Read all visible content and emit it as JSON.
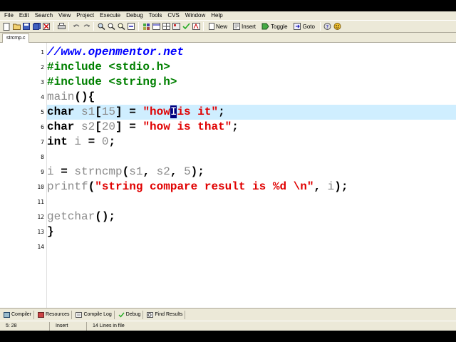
{
  "menu": {
    "items": [
      {
        "label": "File"
      },
      {
        "label": "Edit"
      },
      {
        "label": "Search"
      },
      {
        "label": "View"
      },
      {
        "label": "Project"
      },
      {
        "label": "Execute"
      },
      {
        "label": "Debug"
      },
      {
        "label": "Tools"
      },
      {
        "label": "CVS"
      },
      {
        "label": "Window"
      },
      {
        "label": "Help"
      }
    ]
  },
  "toolbar": {
    "new_label": "New",
    "insert_label": "Insert",
    "toggle_label": "Toggle",
    "goto_label": "Goto"
  },
  "tabs": {
    "file_tab": "strcmp.c"
  },
  "editor": {
    "line_numbers": [
      "1",
      "2",
      "3",
      "4",
      "5",
      "6",
      "7",
      "8",
      "9",
      "10",
      "11",
      "12",
      "13",
      "14"
    ],
    "lines": [
      {
        "parts": [
          {
            "cls": "cm",
            "text": "//www.openmentor.net"
          }
        ]
      },
      {
        "parts": [
          {
            "cls": "pp",
            "text": "#include <stdio.h>"
          }
        ]
      },
      {
        "parts": [
          {
            "cls": "pp",
            "text": "#include <string.h>"
          }
        ]
      },
      {
        "parts": [
          {
            "cls": "fn",
            "text": "main"
          },
          {
            "cls": "sym",
            "text": "(){"
          }
        ]
      },
      {
        "parts": [
          {
            "cls": "kw",
            "text": "char "
          },
          {
            "cls": "fn",
            "text": "s1"
          },
          {
            "cls": "sym",
            "text": "["
          },
          {
            "cls": "num",
            "text": "15"
          },
          {
            "cls": "sym",
            "text": "] = "
          },
          {
            "cls": "st",
            "text": "\"how"
          },
          {
            "cls": "caret",
            "text": "I"
          },
          {
            "cls": "st",
            "text": "is it\""
          },
          {
            "cls": "sym",
            "text": ";"
          }
        ]
      },
      {
        "parts": [
          {
            "cls": "kw",
            "text": "char "
          },
          {
            "cls": "fn",
            "text": "s2"
          },
          {
            "cls": "sym",
            "text": "["
          },
          {
            "cls": "num",
            "text": "20"
          },
          {
            "cls": "sym",
            "text": "] = "
          },
          {
            "cls": "st",
            "text": "\"how is that\""
          },
          {
            "cls": "sym",
            "text": ";"
          }
        ]
      },
      {
        "parts": [
          {
            "cls": "kw",
            "text": "int "
          },
          {
            "cls": "fn",
            "text": "i"
          },
          {
            "cls": "sym",
            "text": " = "
          },
          {
            "cls": "num",
            "text": "0"
          },
          {
            "cls": "sym",
            "text": ";"
          }
        ]
      },
      {
        "parts": []
      },
      {
        "parts": [
          {
            "cls": "fn",
            "text": "i"
          },
          {
            "cls": "sym",
            "text": " = "
          },
          {
            "cls": "fn",
            "text": "strncmp"
          },
          {
            "cls": "sym",
            "text": "("
          },
          {
            "cls": "fn",
            "text": "s1"
          },
          {
            "cls": "sym",
            "text": ", "
          },
          {
            "cls": "fn",
            "text": "s2"
          },
          {
            "cls": "sym",
            "text": ", "
          },
          {
            "cls": "num",
            "text": "5"
          },
          {
            "cls": "sym",
            "text": ");"
          }
        ]
      },
      {
        "parts": [
          {
            "cls": "fn",
            "text": "printf"
          },
          {
            "cls": "sym",
            "text": "("
          },
          {
            "cls": "st",
            "text": "\"string compare result is %d \\n\""
          },
          {
            "cls": "sym",
            "text": ", "
          },
          {
            "cls": "fn",
            "text": "i"
          },
          {
            "cls": "sym",
            "text": ");"
          }
        ]
      },
      {
        "parts": []
      },
      {
        "parts": [
          {
            "cls": "fn",
            "text": "getchar"
          },
          {
            "cls": "sym",
            "text": "();"
          }
        ]
      },
      {
        "parts": [
          {
            "cls": "sym",
            "text": "}"
          }
        ]
      },
      {
        "parts": []
      }
    ],
    "active_line": 5
  },
  "bottom_tabs": {
    "compiler": "Compiler",
    "resources": "Resources",
    "compile_log": "Compile Log",
    "debug": "Debug",
    "find_results": "Find Results"
  },
  "status": {
    "position": "5: 28",
    "mode": "Insert",
    "lines_info": "14 Lines in file"
  }
}
